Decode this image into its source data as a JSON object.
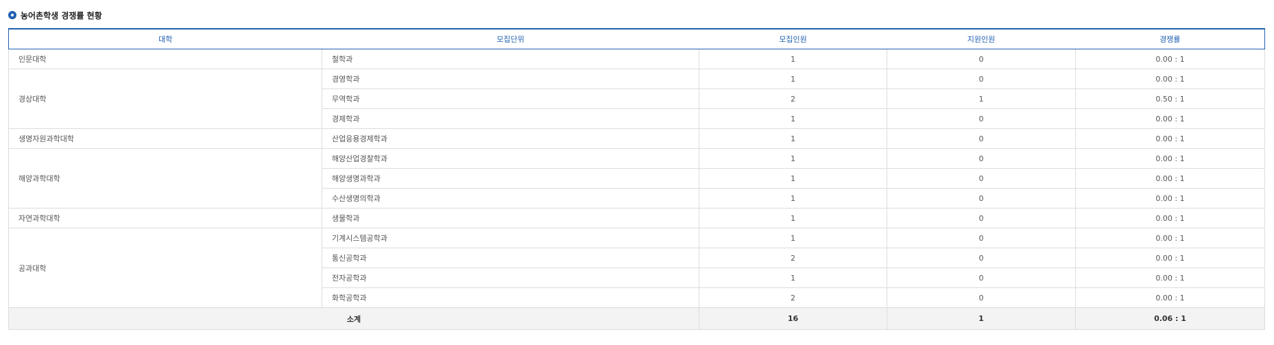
{
  "section": {
    "title": "농어촌학생 경쟁률 현황"
  },
  "table": {
    "headers": {
      "college": "대학",
      "unit": "모집단위",
      "quota": "모집인원",
      "applicants": "지원인원",
      "ratio": "경쟁률"
    },
    "groups": [
      {
        "college": "인문대학",
        "rows": [
          {
            "unit": "철학과",
            "quota": "1",
            "applicants": "0",
            "ratio": "0.00 : 1"
          }
        ]
      },
      {
        "college": "경상대학",
        "rows": [
          {
            "unit": "경영학과",
            "quota": "1",
            "applicants": "0",
            "ratio": "0.00 : 1"
          },
          {
            "unit": "무역학과",
            "quota": "2",
            "applicants": "1",
            "ratio": "0.50 : 1"
          },
          {
            "unit": "경제학과",
            "quota": "1",
            "applicants": "0",
            "ratio": "0.00 : 1"
          }
        ]
      },
      {
        "college": "생명자원과학대학",
        "rows": [
          {
            "unit": "산업응용경제학과",
            "quota": "1",
            "applicants": "0",
            "ratio": "0.00 : 1"
          }
        ]
      },
      {
        "college": "해양과학대학",
        "rows": [
          {
            "unit": "해양산업경찰학과",
            "quota": "1",
            "applicants": "0",
            "ratio": "0.00 : 1"
          },
          {
            "unit": "해양생명과학과",
            "quota": "1",
            "applicants": "0",
            "ratio": "0.00 : 1"
          },
          {
            "unit": "수산생명의학과",
            "quota": "1",
            "applicants": "0",
            "ratio": "0.00 : 1"
          }
        ]
      },
      {
        "college": "자연과학대학",
        "rows": [
          {
            "unit": "생물학과",
            "quota": "1",
            "applicants": "0",
            "ratio": "0.00 : 1"
          }
        ]
      },
      {
        "college": "공과대학",
        "rows": [
          {
            "unit": "기계시스템공학과",
            "quota": "1",
            "applicants": "0",
            "ratio": "0.00 : 1"
          },
          {
            "unit": "통신공학과",
            "quota": "2",
            "applicants": "0",
            "ratio": "0.00 : 1"
          },
          {
            "unit": "전자공학과",
            "quota": "1",
            "applicants": "0",
            "ratio": "0.00 : 1"
          },
          {
            "unit": "화학공학과",
            "quota": "2",
            "applicants": "0",
            "ratio": "0.00 : 1"
          }
        ]
      }
    ],
    "total": {
      "label": "소계",
      "quota": "16",
      "applicants": "1",
      "ratio": "0.06 : 1"
    }
  },
  "colors": {
    "accent": "#1d5fb0",
    "border": "#dcdcdc",
    "total_bg": "#f3f3f3"
  }
}
